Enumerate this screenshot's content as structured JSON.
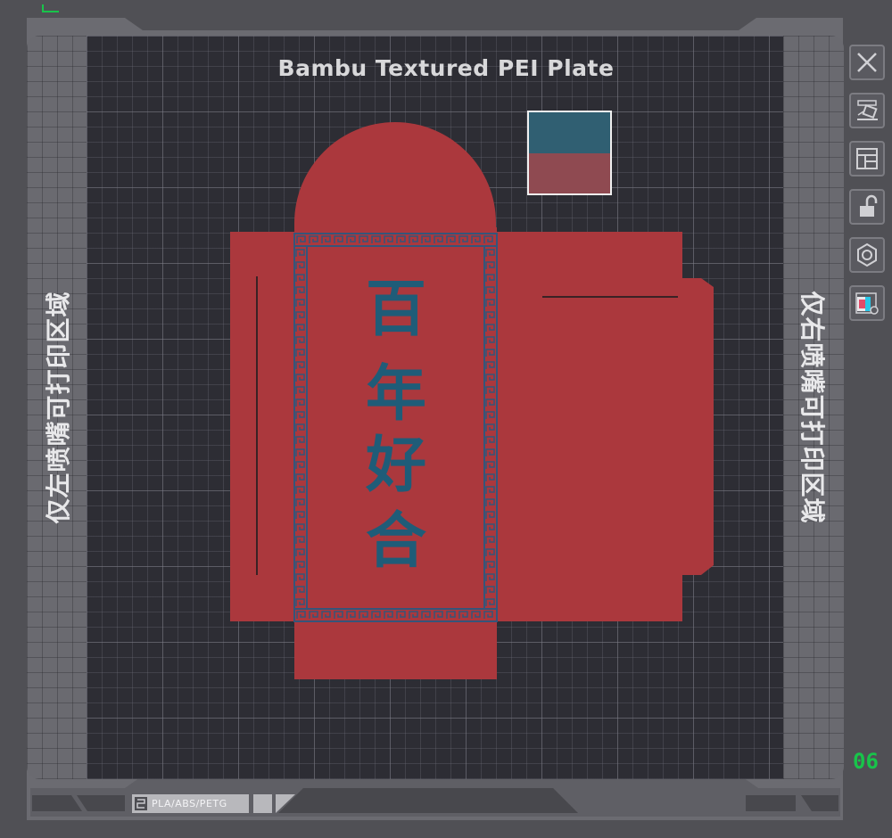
{
  "plate": {
    "title": "Bambu Textured PEI Plate",
    "left_zone_label": "仅左喷嘴可打印区域",
    "right_zone_label": "仅右喷嘴可打印区域",
    "plate_number": "06",
    "filament_types": "PLA/ABS/PETG"
  },
  "model": {
    "text": [
      "百",
      "年",
      "好",
      "合"
    ],
    "body_color": "#ab383d",
    "text_color": "#1f5c78",
    "swatch_colors": [
      "#305f72",
      "#8f4a51"
    ]
  },
  "toolbar": {
    "buttons": [
      {
        "icon": "close-icon"
      },
      {
        "icon": "auto-orient-icon"
      },
      {
        "icon": "arrange-icon"
      },
      {
        "icon": "lock-icon"
      },
      {
        "icon": "plate-settings-icon"
      },
      {
        "icon": "filament-grouping-icon"
      }
    ]
  },
  "colors": {
    "plate_bg": "#2d2d34",
    "frame": "#6a6a70",
    "accent_green": "#18c44a"
  }
}
